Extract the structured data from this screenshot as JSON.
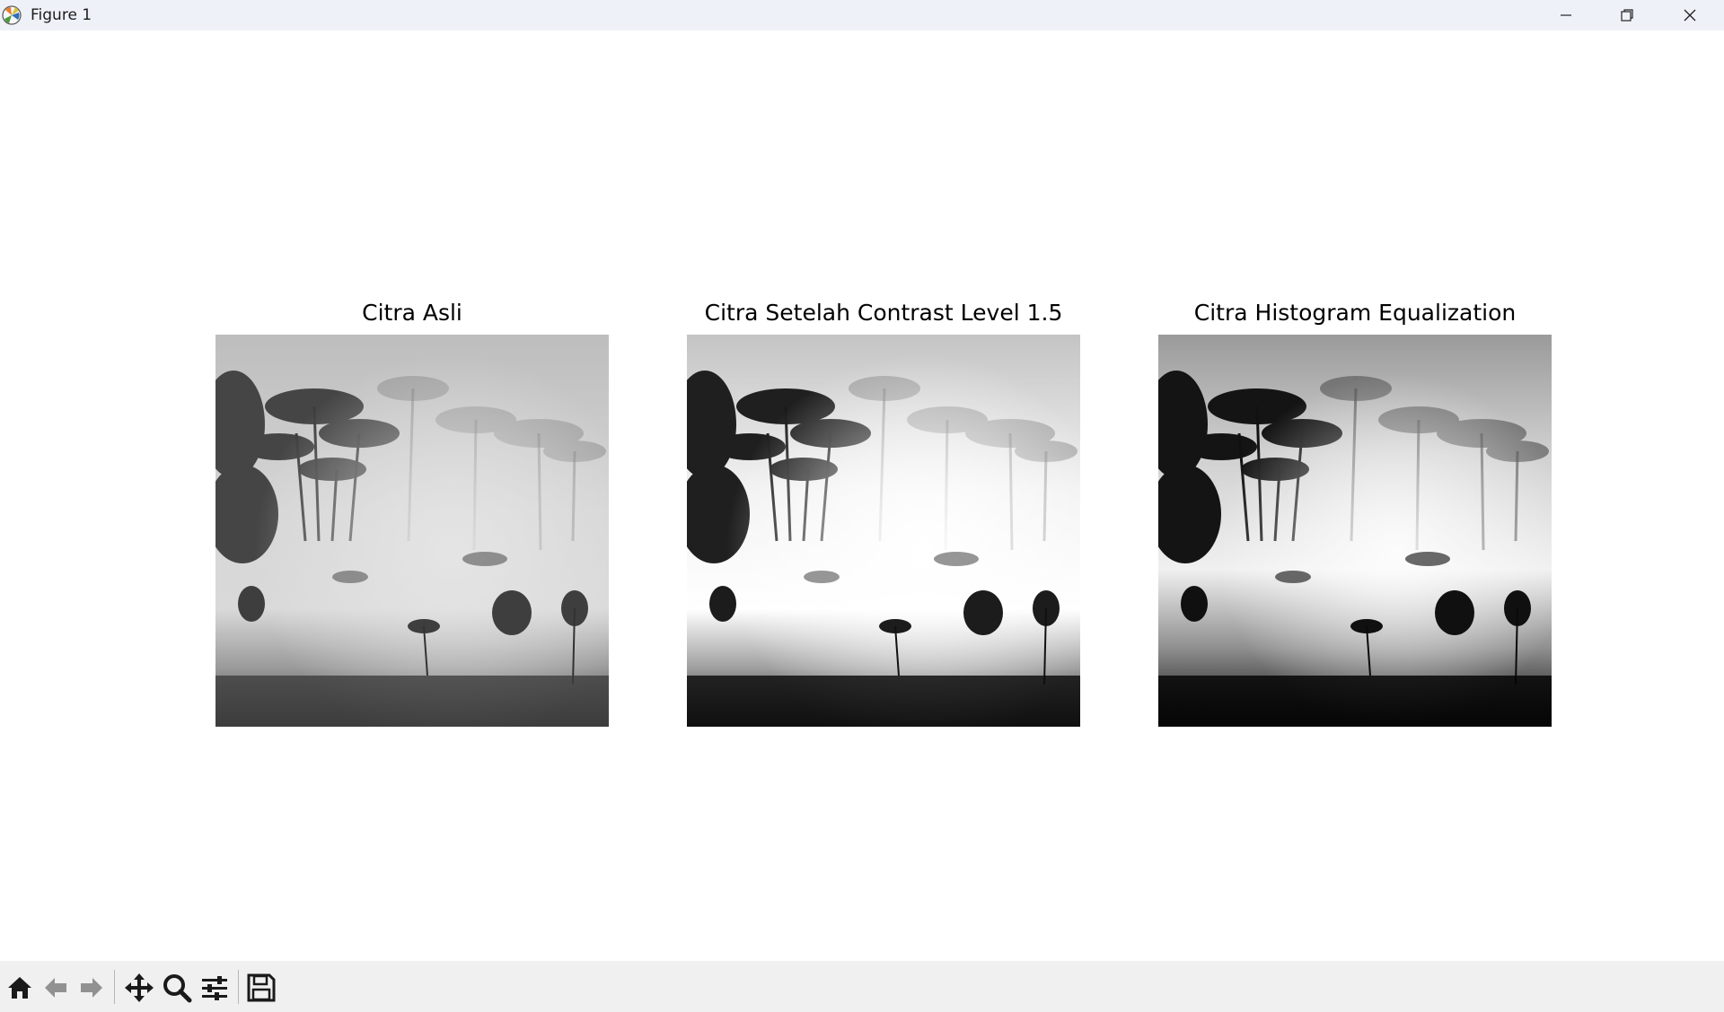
{
  "window": {
    "title": "Figure 1",
    "icon": "matplotlib-logo-icon",
    "controls": [
      "minimize-icon",
      "restore-icon",
      "close-icon"
    ]
  },
  "figure": {
    "panels": [
      {
        "title": "Citra Asli",
        "variant": "original"
      },
      {
        "title": "Citra Setelah Contrast Level 1.5",
        "variant": "contrast"
      },
      {
        "title": "Citra Histogram Equalization",
        "variant": "equalized"
      }
    ]
  },
  "toolbar": {
    "tools": [
      {
        "name": "home-icon",
        "enabled": true
      },
      {
        "name": "back-arrow-icon",
        "enabled": false
      },
      {
        "name": "forward-arrow-icon",
        "enabled": false
      },
      {
        "name": "pan-move-icon",
        "enabled": true
      },
      {
        "name": "zoom-magnifier-icon",
        "enabled": true
      },
      {
        "name": "configure-subplots-icon",
        "enabled": true
      },
      {
        "name": "save-floppy-icon",
        "enabled": true
      }
    ]
  },
  "colors": {
    "titlebar": "#eef2f8",
    "toolbar": "#f0f0f0",
    "canvas": "#ffffff"
  }
}
